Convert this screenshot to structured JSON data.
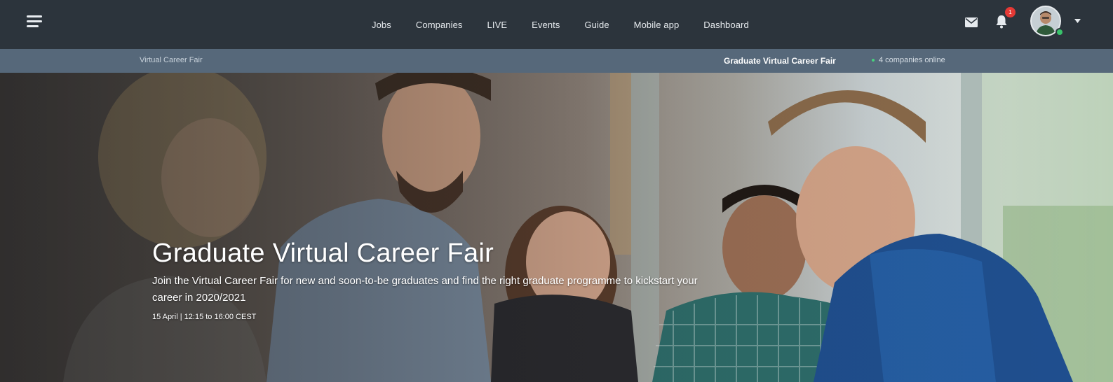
{
  "nav": {
    "links": [
      "Jobs",
      "Companies",
      "LIVE",
      "Events",
      "Guide",
      "Mobile app",
      "Dashboard"
    ],
    "notification_count": "1",
    "icons": {
      "menu": "hamburger-menu-icon",
      "mail": "envelope-icon",
      "bell": "bell-icon",
      "caret": "chevron-down-icon"
    }
  },
  "subnav": {
    "breadcrumb": "Virtual Career Fair",
    "fair_name": "Graduate Virtual Career Fair",
    "online_status": "4 companies online"
  },
  "hero": {
    "title": "Graduate Virtual Career Fair",
    "description": "Join the Virtual Career Fair for new and soon-to-be graduates and find the right graduate programme to kickstart your career in 2020/2021",
    "date": "15 April | 12:15 to 16:00   CEST"
  },
  "colors": {
    "nav_bg": "#2c343c",
    "subnav_bg": "#56687a",
    "badge": "#e53935",
    "online": "#39c26b"
  }
}
